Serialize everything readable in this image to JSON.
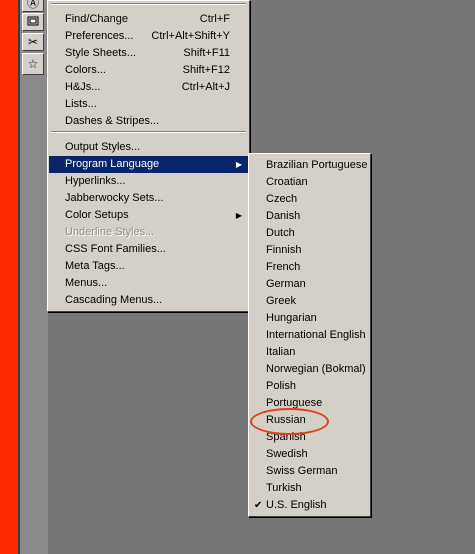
{
  "main_menu": {
    "items": [
      {
        "label": "Find/Change",
        "shortcut": "Ctrl+F"
      },
      {
        "label": "Preferences...",
        "shortcut": "Ctrl+Alt+Shift+Y"
      },
      {
        "label": "Style Sheets...",
        "shortcut": "Shift+F11"
      },
      {
        "label": "Colors...",
        "shortcut": "Shift+F12"
      },
      {
        "label": "H&Js...",
        "shortcut": "Ctrl+Alt+J"
      },
      {
        "label": "Lists..."
      },
      {
        "label": "Dashes & Stripes..."
      },
      {
        "label": "Output Styles..."
      },
      {
        "label": "Program Language",
        "selected": true,
        "submenu": true
      },
      {
        "label": "Hyperlinks..."
      },
      {
        "label": "Jabberwocky Sets..."
      },
      {
        "label": "Color Setups",
        "submenu": true
      },
      {
        "label": "Underline Styles...",
        "disabled": true
      },
      {
        "label": "CSS Font Families..."
      },
      {
        "label": "Meta Tags..."
      },
      {
        "label": "Menus..."
      },
      {
        "label": "Cascading Menus..."
      }
    ]
  },
  "language_menu": {
    "items": [
      {
        "label": "Brazilian Portuguese"
      },
      {
        "label": "Croatian"
      },
      {
        "label": "Czech"
      },
      {
        "label": "Danish"
      },
      {
        "label": "Dutch"
      },
      {
        "label": "Finnish"
      },
      {
        "label": "French"
      },
      {
        "label": "German"
      },
      {
        "label": "Greek"
      },
      {
        "label": "Hungarian"
      },
      {
        "label": "International English"
      },
      {
        "label": "Italian"
      },
      {
        "label": "Norwegian (Bokmal)"
      },
      {
        "label": "Polish"
      },
      {
        "label": "Portuguese"
      },
      {
        "label": "Russian",
        "highlighted": true
      },
      {
        "label": "Spanish"
      },
      {
        "label": "Swedish"
      },
      {
        "label": "Swiss German"
      },
      {
        "label": "Turkish"
      },
      {
        "label": "U.S. English",
        "checked": true
      }
    ]
  },
  "toolbar": {
    "icons": [
      "link-tool-icon",
      "frame-tool-icon",
      "scissors-tool-icon",
      "star-tool-icon"
    ]
  },
  "colors": {
    "highlight_bg": "#0a246a",
    "menu_bg": "#d4d0c8",
    "annotation_circle": "#e0401a",
    "left_strip": "#ff2a00"
  }
}
